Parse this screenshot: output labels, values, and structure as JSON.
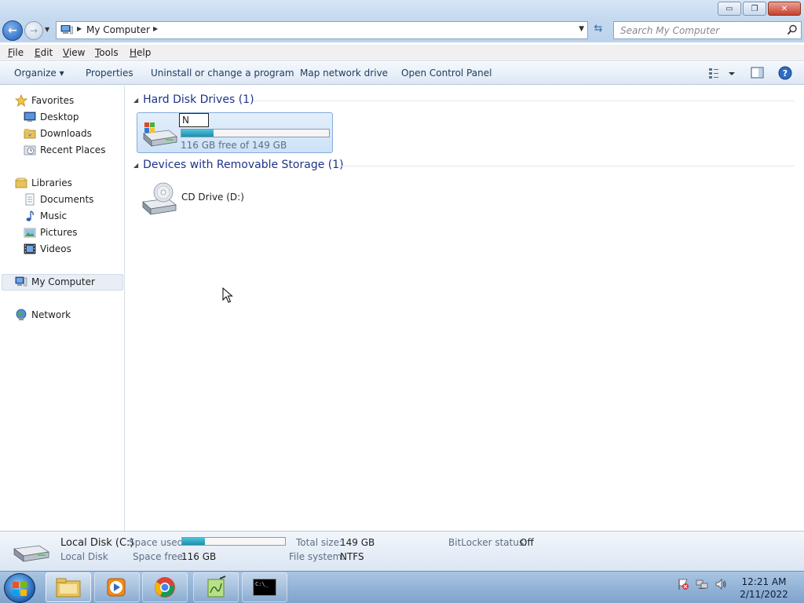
{
  "window": {
    "controls": {
      "minimize": "▭",
      "maximize": "❐",
      "close": "✕"
    }
  },
  "address": {
    "path": "My Computer",
    "search_placeholder": "Search My Computer"
  },
  "menu": [
    {
      "key": "F",
      "rest": "ile"
    },
    {
      "key": "E",
      "rest": "dit"
    },
    {
      "key": "V",
      "rest": "iew"
    },
    {
      "key": "T",
      "rest": "ools"
    },
    {
      "key": "H",
      "rest": "elp"
    }
  ],
  "commands": {
    "organize": "Organize ▾",
    "properties": "Properties",
    "uninstall": "Uninstall or change a program",
    "map_drive": "Map network drive",
    "control_panel": "Open Control Panel"
  },
  "nav": {
    "favorites": "Favorites",
    "desktop": "Desktop",
    "downloads": "Downloads",
    "recent": "Recent Places",
    "libraries": "Libraries",
    "documents": "Documents",
    "music": "Music",
    "pictures": "Pictures",
    "videos": "Videos",
    "computer": "My Computer",
    "network": "Network"
  },
  "content": {
    "hdd_group": "Hard Disk Drives (1)",
    "removable_group": "Devices with Removable Storage (1)",
    "drive_rename_value": "N",
    "drive_free_text": "116 GB free of 149 GB",
    "drive_used_fraction": 0.22,
    "cd_label": "CD Drive (D:)"
  },
  "details": {
    "name": "Local Disk (C:)",
    "type": "Local Disk",
    "space_used_label": "Space used:",
    "space_free_label": "Space free:",
    "space_free_value": "116 GB",
    "total_label": "Total size:",
    "total_value": "149 GB",
    "fs_label": "File system:",
    "fs_value": "NTFS",
    "bitlocker_label": "BitLocker status:",
    "bitlocker_value": "Off",
    "used_fraction": 0.22
  },
  "taskbar": {
    "time": "12:21 AM",
    "date": "2/11/2022",
    "terminal_text": "C:\\_"
  }
}
